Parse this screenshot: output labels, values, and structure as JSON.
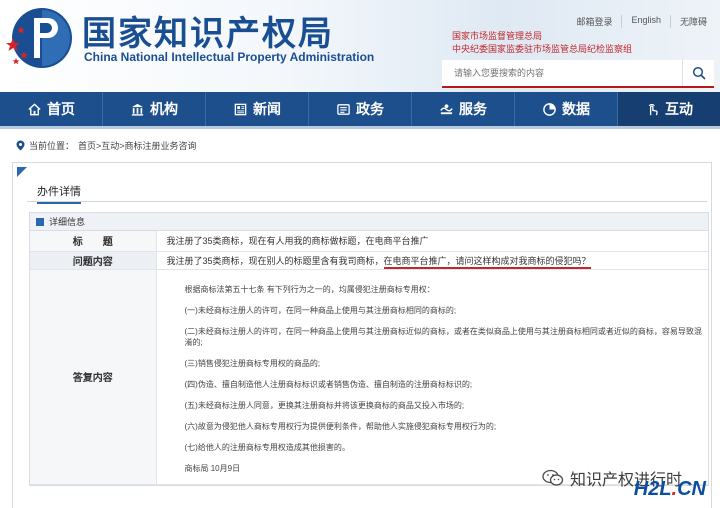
{
  "header": {
    "title_cn": "国家知识产权局",
    "title_en": "China National Intellectual Property Administration",
    "top_links": [
      "邮箱登录",
      "English",
      "无障碍"
    ],
    "gov_links": [
      "国家市场监督管理总局",
      "中央纪委国家监委驻市场监管总局纪检监察组"
    ],
    "search": {
      "placeholder": "请输入您要搜索的内容"
    }
  },
  "nav": {
    "items": [
      {
        "label": "首页",
        "icon": "home-icon"
      },
      {
        "label": "机构",
        "icon": "institution-icon"
      },
      {
        "label": "新闻",
        "icon": "news-icon"
      },
      {
        "label": "政务",
        "icon": "government-icon"
      },
      {
        "label": "服务",
        "icon": "service-icon"
      },
      {
        "label": "数据",
        "icon": "data-icon"
      },
      {
        "label": "互动",
        "icon": "interaction-icon"
      }
    ],
    "active": "互动"
  },
  "breadcrumb": {
    "prefix": "当前位置：",
    "path": "首页>互动>商标注册业务咨询"
  },
  "detail": {
    "tab_title": "办件详情",
    "panel_title": "详细信息",
    "title_label": "标　　题",
    "title_value": "我注册了35类商标，现在有人用我的商标做标题，在电商平台推广",
    "question_label": "问题内容",
    "question_value_plain": "我注册了35类商标，现在别人的标题里含有我司商标，",
    "question_value_highlight": "在电商平台推广，请问这样构成对我商标的侵犯吗？",
    "answer_label": "答复内容",
    "answer_lines": [
      "根据商标法第五十七条 有下列行为之一的，均属侵犯注册商标专用权：",
      "(一)未经商标注册人的许可，在同一种商品上使用与其注册商标相同的商标的;",
      "(二)未经商标注册人的许可，在同一种商品上使用与其注册商标近似的商标，或者在类似商品上使用与其注册商标相同或者近似的商标，容易导致混淆的;",
      "(三)销售侵犯注册商标专用权的商品的;",
      "(四)伪造、擅自制造他人注册商标标识或者销售伪造、擅自制造的注册商标标识的;",
      "(五)未经商标注册人同意，更换其注册商标并将该更换商标的商品又投入市场的;",
      "(六)故意为侵犯他人商标专用权行为提供便利条件，帮助他人实施侵犯商标专用权行为的;",
      "(七)给他人的注册商标专用权造成其他损害的。",
      "商标局 10月9日"
    ]
  },
  "watermark": {
    "text": "知识产权进行时",
    "brand_a": "H2L",
    "brand_dot": ".",
    "brand_b": "CN"
  },
  "colors": {
    "brand_blue": "#1e4f8d",
    "accent_red": "#c0282d"
  }
}
